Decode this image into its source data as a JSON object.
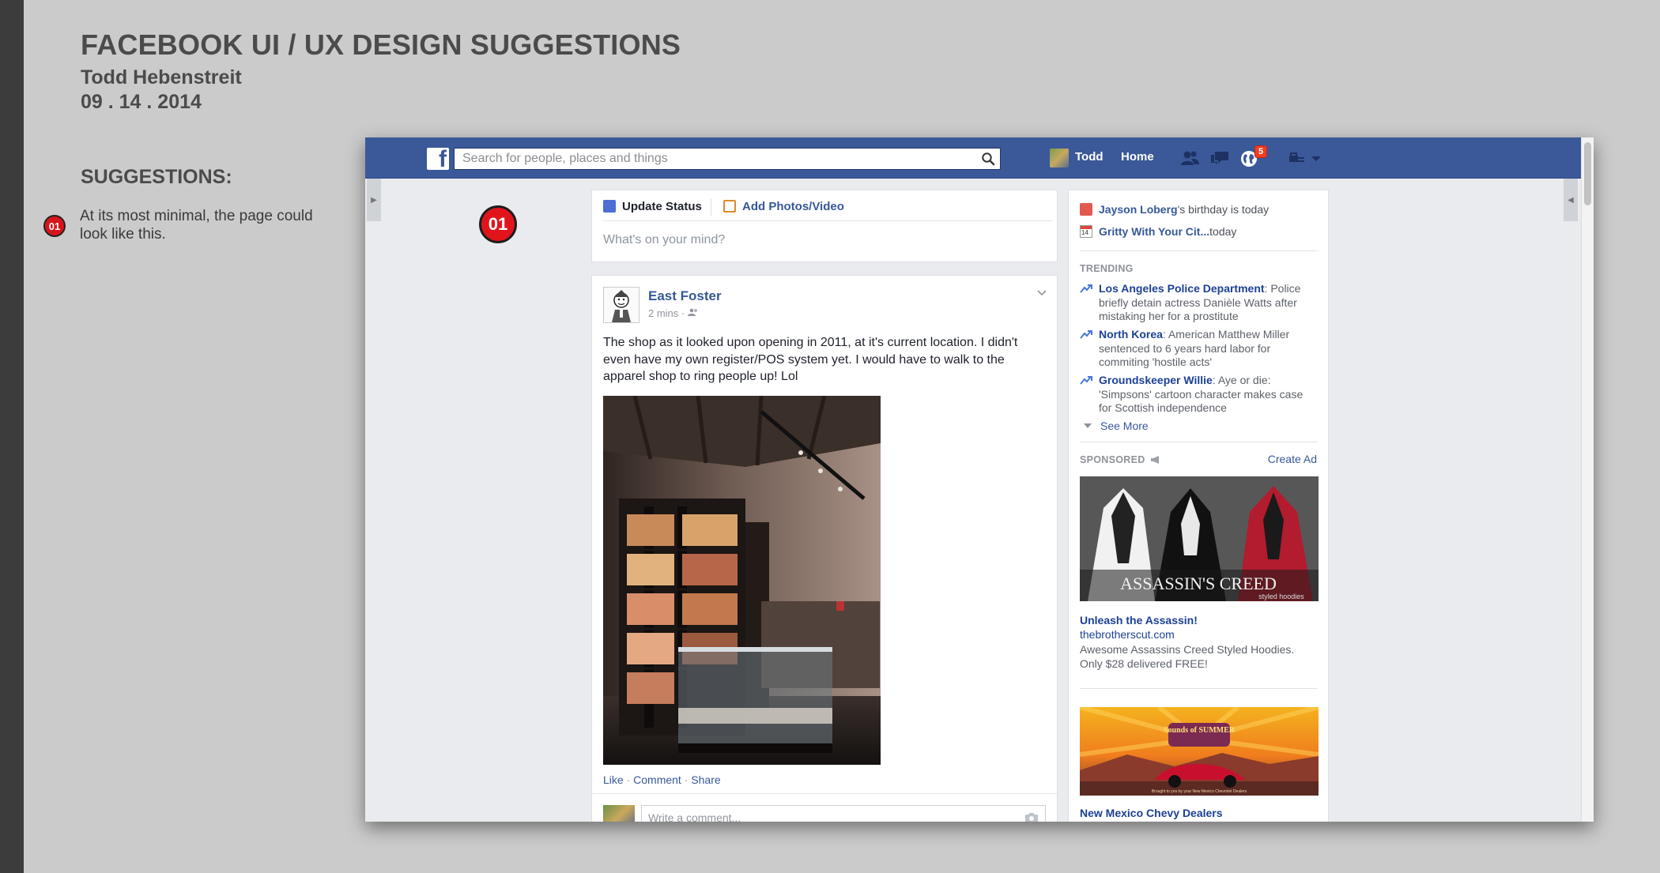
{
  "doc": {
    "title": "FACEBOOK UI / UX DESIGN SUGGESTIONS",
    "author": "Todd Hebenstreit",
    "date": "09 . 14 . 2014",
    "suggestions_heading": "SUGGESTIONS:",
    "suggestion_number": "01",
    "suggestion_text": "At its most minimal, the page could look like this."
  },
  "topbar": {
    "search_placeholder": "Search for people, places and things",
    "user_name": "Todd",
    "home_label": "Home",
    "notification_count": "5"
  },
  "page_badge": "01",
  "composer": {
    "update_status": "Update Status",
    "add_photos": "Add Photos/Video",
    "prompt": "What's on your mind?"
  },
  "post": {
    "author": "East Foster",
    "time": "2 mins ·",
    "text": "The shop as it looked upon opening in 2011, at it's current location. I didn't even have my own register/POS system yet. I would have to walk to the apparel shop to ring people up! Lol",
    "actions": [
      "Like",
      "Comment",
      "Share"
    ],
    "comment_placeholder": "Write a comment..."
  },
  "sidebar": {
    "birthday_name": "Jayson Loberg",
    "birthday_suffix": "'s birthday is today",
    "event_name": "Gritty With Your Cit...",
    "event_suffix": " today",
    "calendar_day": "14",
    "trending_label": "TRENDING",
    "trends": [
      {
        "topic": "Los Angeles Police Department",
        "text": ": Police briefly detain actress Danièle Watts after mistaking her for a prostitute"
      },
      {
        "topic": "North Korea",
        "text": ": American Matthew Miller sentenced to 6 years hard labor for commiting 'hostile acts'"
      },
      {
        "topic": "Groundskeeper Willie",
        "text": ": Aye or die: 'Simpsons' cartoon character makes case for Scottish independence"
      }
    ],
    "see_more": "See More",
    "sponsored_label": "SPONSORED",
    "create_ad": "Create Ad",
    "ads": [
      {
        "title": "Unleash the Assassin!",
        "url": "thebrotherscut.com",
        "desc": "Awesome Assassins Creed Styled Hoodies. Only $28 delivered FREE!",
        "banner_text": "ASSASSIN'S CREED",
        "banner_sub": "styled hoodies"
      },
      {
        "title": "New Mexico Chevy Dealers",
        "banner_text": "Sounds of SUMMER",
        "banner_sub": "Brought to you by your New Mexico Chevrolet Dealers"
      }
    ]
  },
  "colors": {
    "fb_blue": "#3b5998",
    "link": "#365899",
    "badge_red": "#e1141c"
  }
}
